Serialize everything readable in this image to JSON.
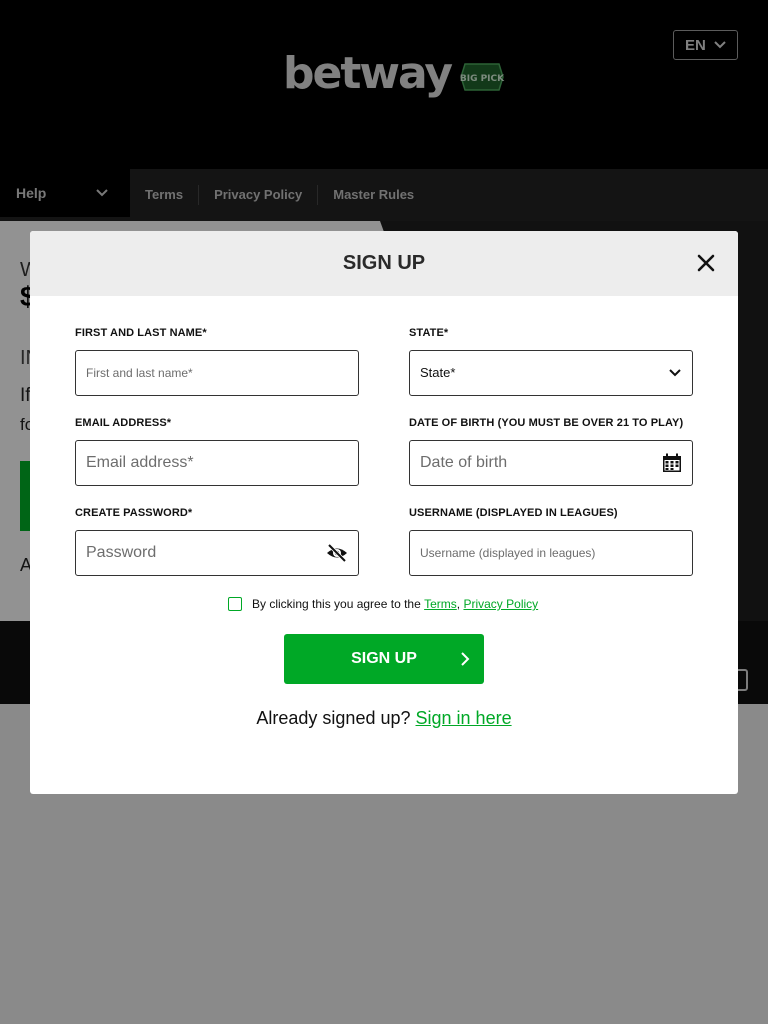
{
  "header": {
    "logo_text": "betway",
    "logo_badge_text": "BIG PICK",
    "language": "EN"
  },
  "nav": {
    "help_label": "Help",
    "links": [
      "Terms",
      "Privacy Policy",
      "Master Rules"
    ]
  },
  "background": {
    "line1": "W",
    "line2": "$",
    "line3": "IN",
    "line4": "If",
    "line5": "fo",
    "line6": "A"
  },
  "modal": {
    "title": "SIGN UP",
    "fields": {
      "name": {
        "label": "FIRST AND LAST NAME*",
        "placeholder": "First and last name*"
      },
      "state": {
        "label": "STATE*",
        "value": "State*"
      },
      "email": {
        "label": "EMAIL ADDRESS*",
        "placeholder": "Email address*"
      },
      "dob": {
        "label": "DATE OF BIRTH (YOU MUST BE OVER 21 TO PLAY)",
        "placeholder": "Date of birth"
      },
      "password": {
        "label": "CREATE PASSWORD*",
        "placeholder": "Password"
      },
      "username": {
        "label": "USERNAME (DISPLAYED IN LEAGUES)",
        "placeholder": "Username (displayed in leagues)"
      }
    },
    "agree": {
      "text": "By clicking this you agree to the",
      "terms_link": "Terms",
      "separator": ",",
      "privacy_link": "Privacy Policy"
    },
    "submit_label": "SIGN UP",
    "signin": {
      "text": "Already signed up?",
      "link": "Sign in here"
    }
  },
  "colors": {
    "brand_green": "#00a826",
    "header_bg": "#000000",
    "nav_bg": "#222222"
  }
}
